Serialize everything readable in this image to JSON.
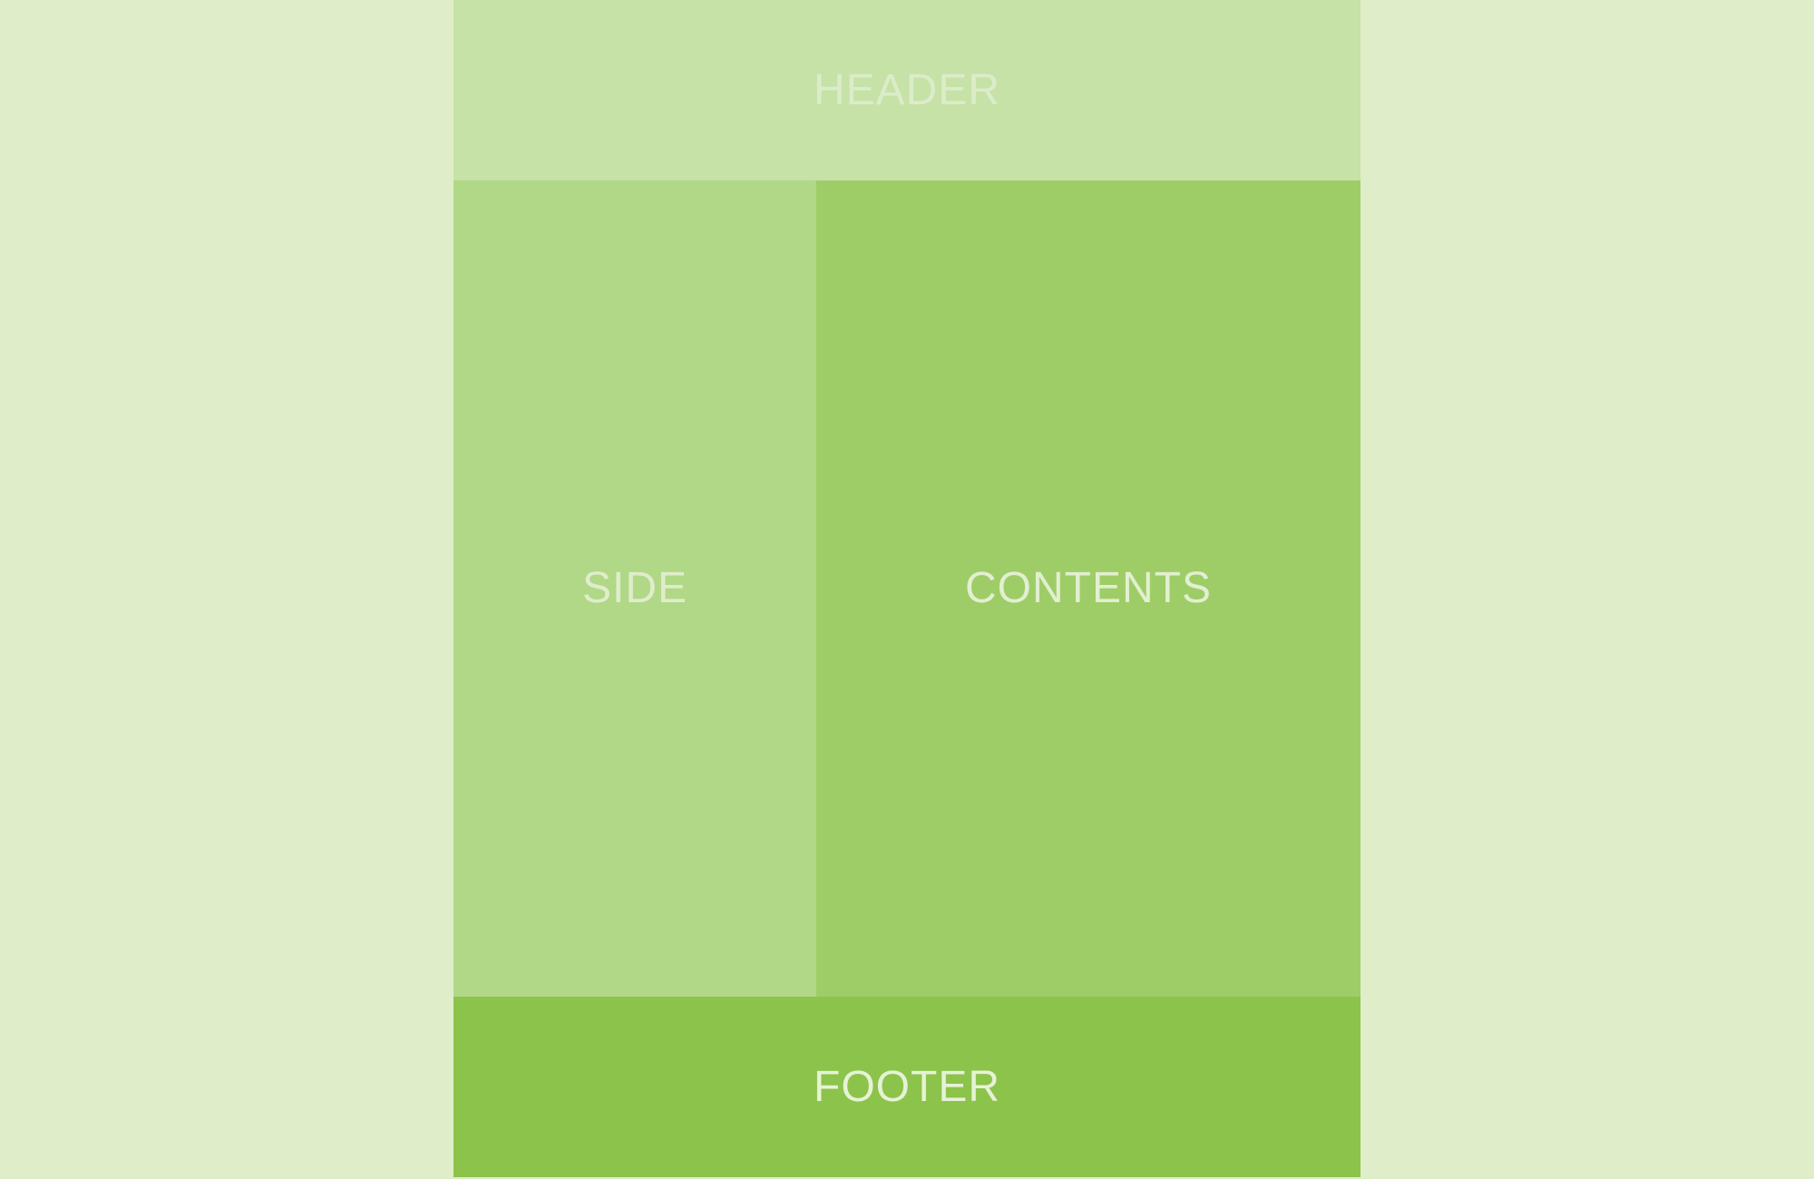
{
  "layout": {
    "header": {
      "label": "HEADER",
      "color": "#c6e2a7"
    },
    "side": {
      "label": "SIDE",
      "color": "#b0d886"
    },
    "contents": {
      "label": "CONTENTS",
      "color": "#9ecd67"
    },
    "footer": {
      "label": "FOOTER",
      "color": "#8cc34b"
    },
    "background_color": "#dfedc8"
  }
}
